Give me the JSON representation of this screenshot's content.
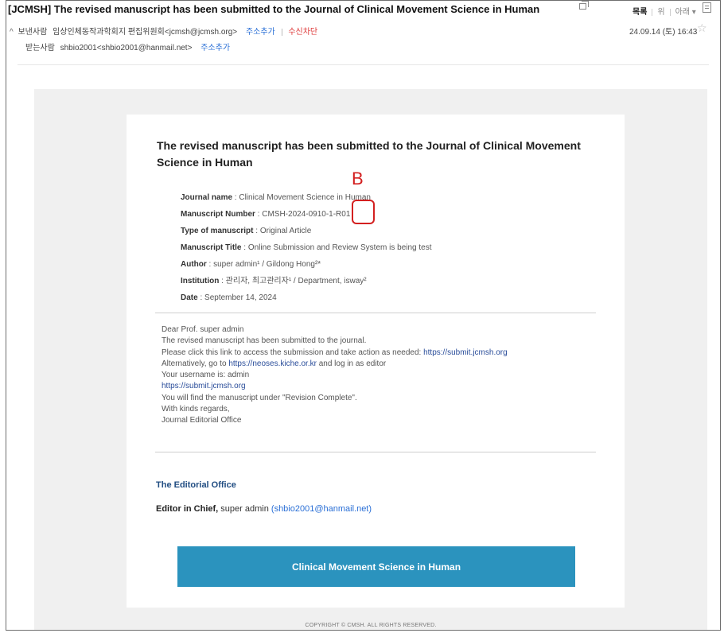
{
  "mail": {
    "subject": "[JCMSH] The revised manuscript has been submitted to the Journal of Clinical Movement Science in Human",
    "toolbar": [
      "목록",
      "위",
      "아래",
      "▾"
    ],
    "sender_caret": "^",
    "sender_label": "보낸사람",
    "sender": "임상인체동작과학회지 편집위원회<jcmsh@jcmsh.org>",
    "add_address": "주소추가",
    "block": "수신차단",
    "date": "24.09.14 (토) 16:43",
    "receiver_label": "받는사람",
    "receiver": "shbio2001<shbio2001@hanmail.net>",
    "receiver_add": "주소추가"
  },
  "body": {
    "title": "The revised manuscript has been submitted to the Journal of Clinical Movement Science in Human",
    "info": [
      {
        "k": "Journal name",
        "v": " : Clinical Movement Science in Human"
      },
      {
        "k": "Manuscript Number",
        "v": " : CMSH-2024-0910-1-R01"
      },
      {
        "k": "Type of manuscript",
        "v": " : Original Article"
      },
      {
        "k": "Manuscript Title",
        "v": " : Online Submission and Review System is being test"
      },
      {
        "k": "Author",
        "v": " : super admin¹ / Gildong Hong²*"
      },
      {
        "k": "Institution",
        "v": " : 관리자, 최고관리자¹ / Department, isway²"
      },
      {
        "k": "Date",
        "v": " : September 14, 2024"
      }
    ],
    "annotation": "B",
    "message": {
      "greeting": "Dear Prof. super admin",
      "line1": "The revised manuscript has been submitted to the journal.",
      "line2_pre": "Please click this link to access the submission and take action as needed: ",
      "line2_link": "https://submit.jcmsh.org",
      "line3_pre": "Alternatively, go to ",
      "line3_link": "https://neoses.kiche.or.kr",
      "line3_post": " and log in as editor",
      "line4": "Your username is: admin",
      "line5_link": "https://submit.jcmsh.org",
      "line6": "You will find the manuscript under \"Revision Complete\".",
      "line7": "With kinds regards,",
      "line8": "Journal Editorial Office"
    },
    "editorial_title": "The Editorial Office",
    "editor_label": "Editor in Chief,",
    "editor_name": " super admin ",
    "editor_email_open": "(",
    "editor_email": "shbio2001@hanmail.net",
    "editor_email_close": ")",
    "banner": "Clinical Movement Science in Human",
    "copyright": "COPYRIGHT © CMSH. ALL RIGHTS RESERVED."
  }
}
